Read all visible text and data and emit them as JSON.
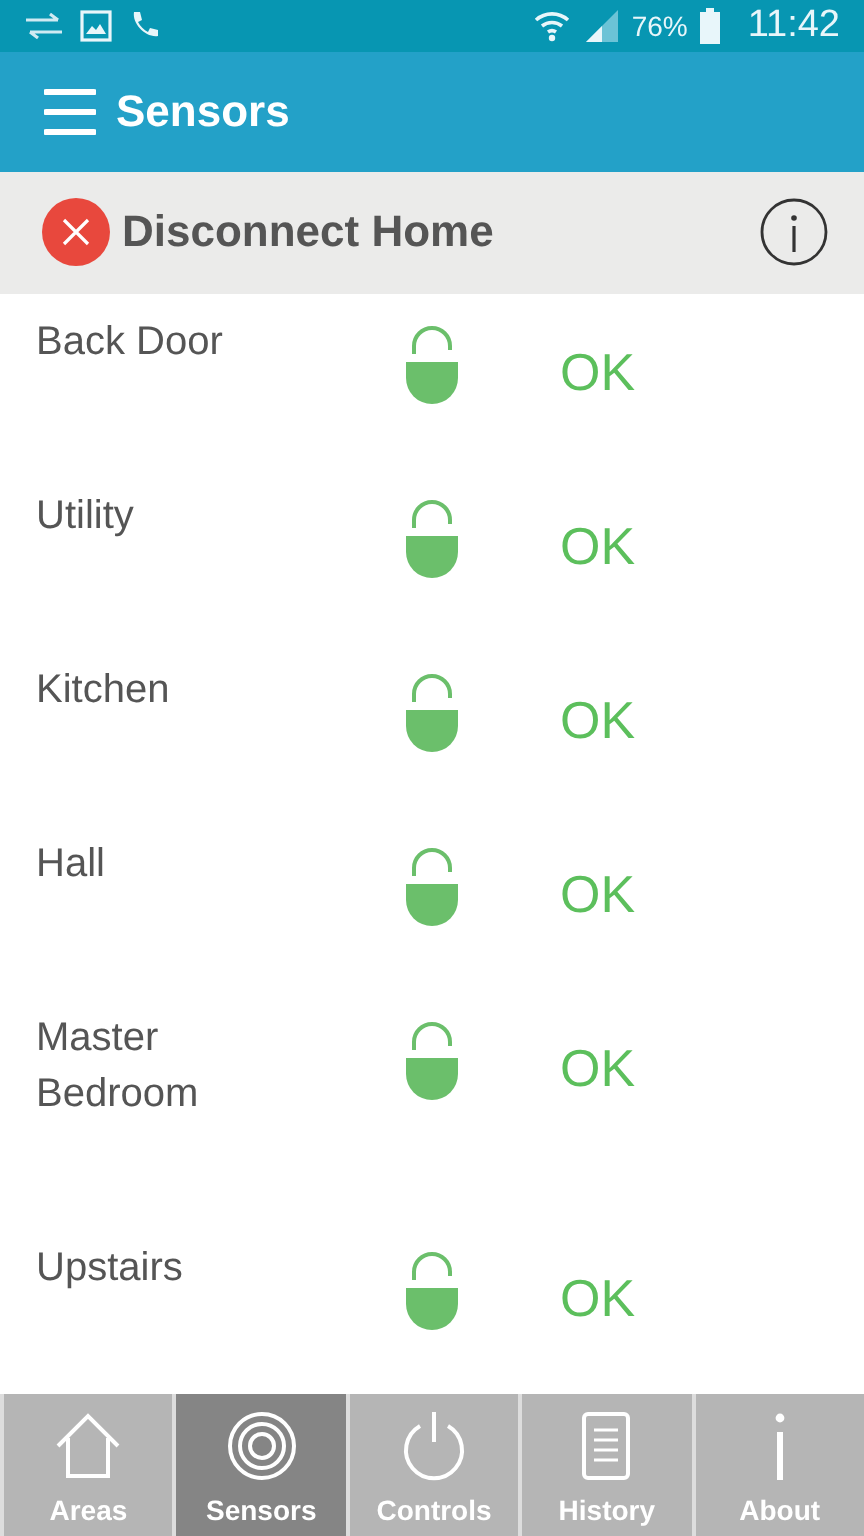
{
  "status_bar": {
    "battery": "76%",
    "time": "11:42"
  },
  "app_bar": {
    "title": "Sensors"
  },
  "connection": {
    "label": "Disconnect Home"
  },
  "sensors": [
    {
      "name": "Back Door",
      "locked": false,
      "status": "OK"
    },
    {
      "name": "Utility",
      "locked": false,
      "status": "OK"
    },
    {
      "name": "Kitchen",
      "locked": false,
      "status": "OK"
    },
    {
      "name": "Hall",
      "locked": false,
      "status": "OK"
    },
    {
      "name": "Master Bedroom",
      "locked": false,
      "status": "OK"
    },
    {
      "name": "Upstairs",
      "locked": false,
      "status": "OK"
    }
  ],
  "tabs": [
    {
      "label": "Areas",
      "selected": false
    },
    {
      "label": "Sensors",
      "selected": true
    },
    {
      "label": "Controls",
      "selected": false
    },
    {
      "label": "History",
      "selected": false
    },
    {
      "label": "About",
      "selected": false
    }
  ]
}
